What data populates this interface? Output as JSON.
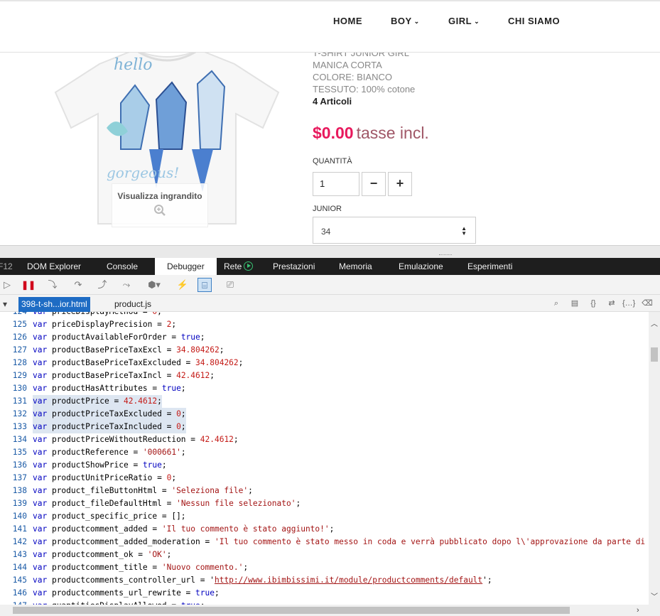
{
  "site": {
    "nav": [
      {
        "label": "HOME",
        "dropdown": false
      },
      {
        "label": "BOY",
        "dropdown": true
      },
      {
        "label": "GIRL",
        "dropdown": true
      },
      {
        "label": "CHI SIAMO",
        "dropdown": false
      }
    ],
    "product": {
      "desc_lines": [
        "T-SHIRT JUNIOR GIRL",
        "MANICA CORTA",
        "COLORE: BIANCO",
        "TESSUTO: 100% cotone"
      ],
      "stock": "4 Articoli",
      "price": "$0.00",
      "tax_label": "tasse incl.",
      "zoom_label": "Visualizza ingrandito",
      "qty_label": "QUANTITÀ",
      "qty_value": "1",
      "minus": "−",
      "plus": "+",
      "size_label": "JUNIOR",
      "size_value": "34"
    },
    "colors": {
      "price": "#e8195d",
      "tax": "#a05767"
    }
  },
  "devtools": {
    "tabs": [
      "F12",
      "DOM Explorer",
      "Console",
      "Debugger",
      "Rete",
      "Prestazioni",
      "Memoria",
      "Emulazione",
      "Esperimenti"
    ],
    "active_tab": "Debugger",
    "file_tabs": [
      "398-t-sh...ior.html",
      "product.js"
    ],
    "active_file": "398-t-sh...ior.html",
    "toolbar_icons": [
      "continue-icon",
      "break-icon",
      "step-into-icon",
      "step-over-icon",
      "step-out-icon",
      "break-on-new-worker-icon",
      "exception-icon",
      "disconnect-icon",
      "just-my-code-icon",
      "pretty-print-icon"
    ],
    "lines": [
      {
        "n": "124",
        "parts": [
          {
            "t": "kw",
            "v": "var"
          },
          {
            "t": "",
            "v": " priceDisplayMethod = "
          },
          {
            "t": "num",
            "v": "0"
          },
          {
            "t": "",
            "v": ";"
          }
        ]
      },
      {
        "n": "125",
        "parts": [
          {
            "t": "kw",
            "v": "var"
          },
          {
            "t": "",
            "v": " priceDisplayPrecision = "
          },
          {
            "t": "num",
            "v": "2"
          },
          {
            "t": "",
            "v": ";"
          }
        ]
      },
      {
        "n": "126",
        "parts": [
          {
            "t": "kw",
            "v": "var"
          },
          {
            "t": "",
            "v": " productAvailableForOrder = "
          },
          {
            "t": "kw",
            "v": "true"
          },
          {
            "t": "",
            "v": ";"
          }
        ]
      },
      {
        "n": "127",
        "parts": [
          {
            "t": "kw",
            "v": "var"
          },
          {
            "t": "",
            "v": " productBasePriceTaxExcl = "
          },
          {
            "t": "num",
            "v": "34.804262"
          },
          {
            "t": "",
            "v": ";"
          }
        ]
      },
      {
        "n": "128",
        "parts": [
          {
            "t": "kw",
            "v": "var"
          },
          {
            "t": "",
            "v": " productBasePriceTaxExcluded = "
          },
          {
            "t": "num",
            "v": "34.804262"
          },
          {
            "t": "",
            "v": ";"
          }
        ]
      },
      {
        "n": "129",
        "parts": [
          {
            "t": "kw",
            "v": "var"
          },
          {
            "t": "",
            "v": " productBasePriceTaxIncl = "
          },
          {
            "t": "num",
            "v": "42.4612"
          },
          {
            "t": "",
            "v": ";"
          }
        ]
      },
      {
        "n": "130",
        "parts": [
          {
            "t": "kw",
            "v": "var"
          },
          {
            "t": "",
            "v": " productHasAttributes = "
          },
          {
            "t": "kw",
            "v": "true"
          },
          {
            "t": "",
            "v": ";"
          }
        ]
      },
      {
        "n": "131",
        "hl": true,
        "parts": [
          {
            "t": "kw",
            "v": "var"
          },
          {
            "t": "",
            "v": " productPrice = "
          },
          {
            "t": "num",
            "v": "42.4612"
          },
          {
            "t": "",
            "v": ";"
          }
        ]
      },
      {
        "n": "132",
        "hl": true,
        "parts": [
          {
            "t": "kw",
            "v": "var"
          },
          {
            "t": "",
            "v": " productPriceTaxExcluded = "
          },
          {
            "t": "num",
            "v": "0"
          },
          {
            "t": "",
            "v": ";"
          }
        ]
      },
      {
        "n": "133",
        "hl": true,
        "parts": [
          {
            "t": "kw",
            "v": "var"
          },
          {
            "t": "",
            "v": " productPriceTaxIncluded = "
          },
          {
            "t": "num",
            "v": "0"
          },
          {
            "t": "",
            "v": ";"
          }
        ]
      },
      {
        "n": "134",
        "parts": [
          {
            "t": "kw",
            "v": "var"
          },
          {
            "t": "",
            "v": " productPriceWithoutReduction = "
          },
          {
            "t": "num",
            "v": "42.4612"
          },
          {
            "t": "",
            "v": ";"
          }
        ]
      },
      {
        "n": "135",
        "parts": [
          {
            "t": "kw",
            "v": "var"
          },
          {
            "t": "",
            "v": " productReference = "
          },
          {
            "t": "str",
            "v": "'000661'"
          },
          {
            "t": "",
            "v": ";"
          }
        ]
      },
      {
        "n": "136",
        "parts": [
          {
            "t": "kw",
            "v": "var"
          },
          {
            "t": "",
            "v": " productShowPrice = "
          },
          {
            "t": "kw",
            "v": "true"
          },
          {
            "t": "",
            "v": ";"
          }
        ]
      },
      {
        "n": "137",
        "parts": [
          {
            "t": "kw",
            "v": "var"
          },
          {
            "t": "",
            "v": " productUnitPriceRatio = "
          },
          {
            "t": "num",
            "v": "0"
          },
          {
            "t": "",
            "v": ";"
          }
        ]
      },
      {
        "n": "138",
        "parts": [
          {
            "t": "kw",
            "v": "var"
          },
          {
            "t": "",
            "v": " product_fileButtonHtml = "
          },
          {
            "t": "str",
            "v": "'Seleziona file'"
          },
          {
            "t": "",
            "v": ";"
          }
        ]
      },
      {
        "n": "139",
        "parts": [
          {
            "t": "kw",
            "v": "var"
          },
          {
            "t": "",
            "v": " product_fileDefaultHtml = "
          },
          {
            "t": "str",
            "v": "'Nessun file selezionato'"
          },
          {
            "t": "",
            "v": ";"
          }
        ]
      },
      {
        "n": "140",
        "parts": [
          {
            "t": "kw",
            "v": "var"
          },
          {
            "t": "",
            "v": " product_specific_price = [];"
          }
        ]
      },
      {
        "n": "141",
        "parts": [
          {
            "t": "kw",
            "v": "var"
          },
          {
            "t": "",
            "v": " productcomment_added = "
          },
          {
            "t": "str",
            "v": "'Il tuo commento è stato aggiunto!'"
          },
          {
            "t": "",
            "v": ";"
          }
        ]
      },
      {
        "n": "142",
        "parts": [
          {
            "t": "kw",
            "v": "var"
          },
          {
            "t": "",
            "v": " productcomment_added_moderation = "
          },
          {
            "t": "str",
            "v": "'Il tuo commento è stato messo in coda e verrà pubblicato dopo l\\'approvazione da parte di un mo"
          }
        ]
      },
      {
        "n": "143",
        "parts": [
          {
            "t": "kw",
            "v": "var"
          },
          {
            "t": "",
            "v": " productcomment_ok = "
          },
          {
            "t": "str",
            "v": "'OK'"
          },
          {
            "t": "",
            "v": ";"
          }
        ]
      },
      {
        "n": "144",
        "parts": [
          {
            "t": "kw",
            "v": "var"
          },
          {
            "t": "",
            "v": " productcomment_title = "
          },
          {
            "t": "str",
            "v": "'Nuovo commento.'"
          },
          {
            "t": "",
            "v": ";"
          }
        ]
      },
      {
        "n": "145",
        "parts": [
          {
            "t": "kw",
            "v": "var"
          },
          {
            "t": "",
            "v": " productcomments_controller_url = '"
          },
          {
            "t": "url",
            "v": "http://www.ibimbissimi.it/module/productcomments/default"
          },
          {
            "t": "",
            "v": "';"
          }
        ]
      },
      {
        "n": "146",
        "parts": [
          {
            "t": "kw",
            "v": "var"
          },
          {
            "t": "",
            "v": " productcomments_url_rewrite = "
          },
          {
            "t": "kw",
            "v": "true"
          },
          {
            "t": "",
            "v": ";"
          }
        ]
      },
      {
        "n": "147",
        "parts": [
          {
            "t": "kw",
            "v": "var"
          },
          {
            "t": "",
            "v": " quantitiesDisplayAllowed = "
          },
          {
            "t": "kw",
            "v": "true"
          },
          {
            "t": "",
            "v": ";"
          }
        ]
      }
    ]
  }
}
